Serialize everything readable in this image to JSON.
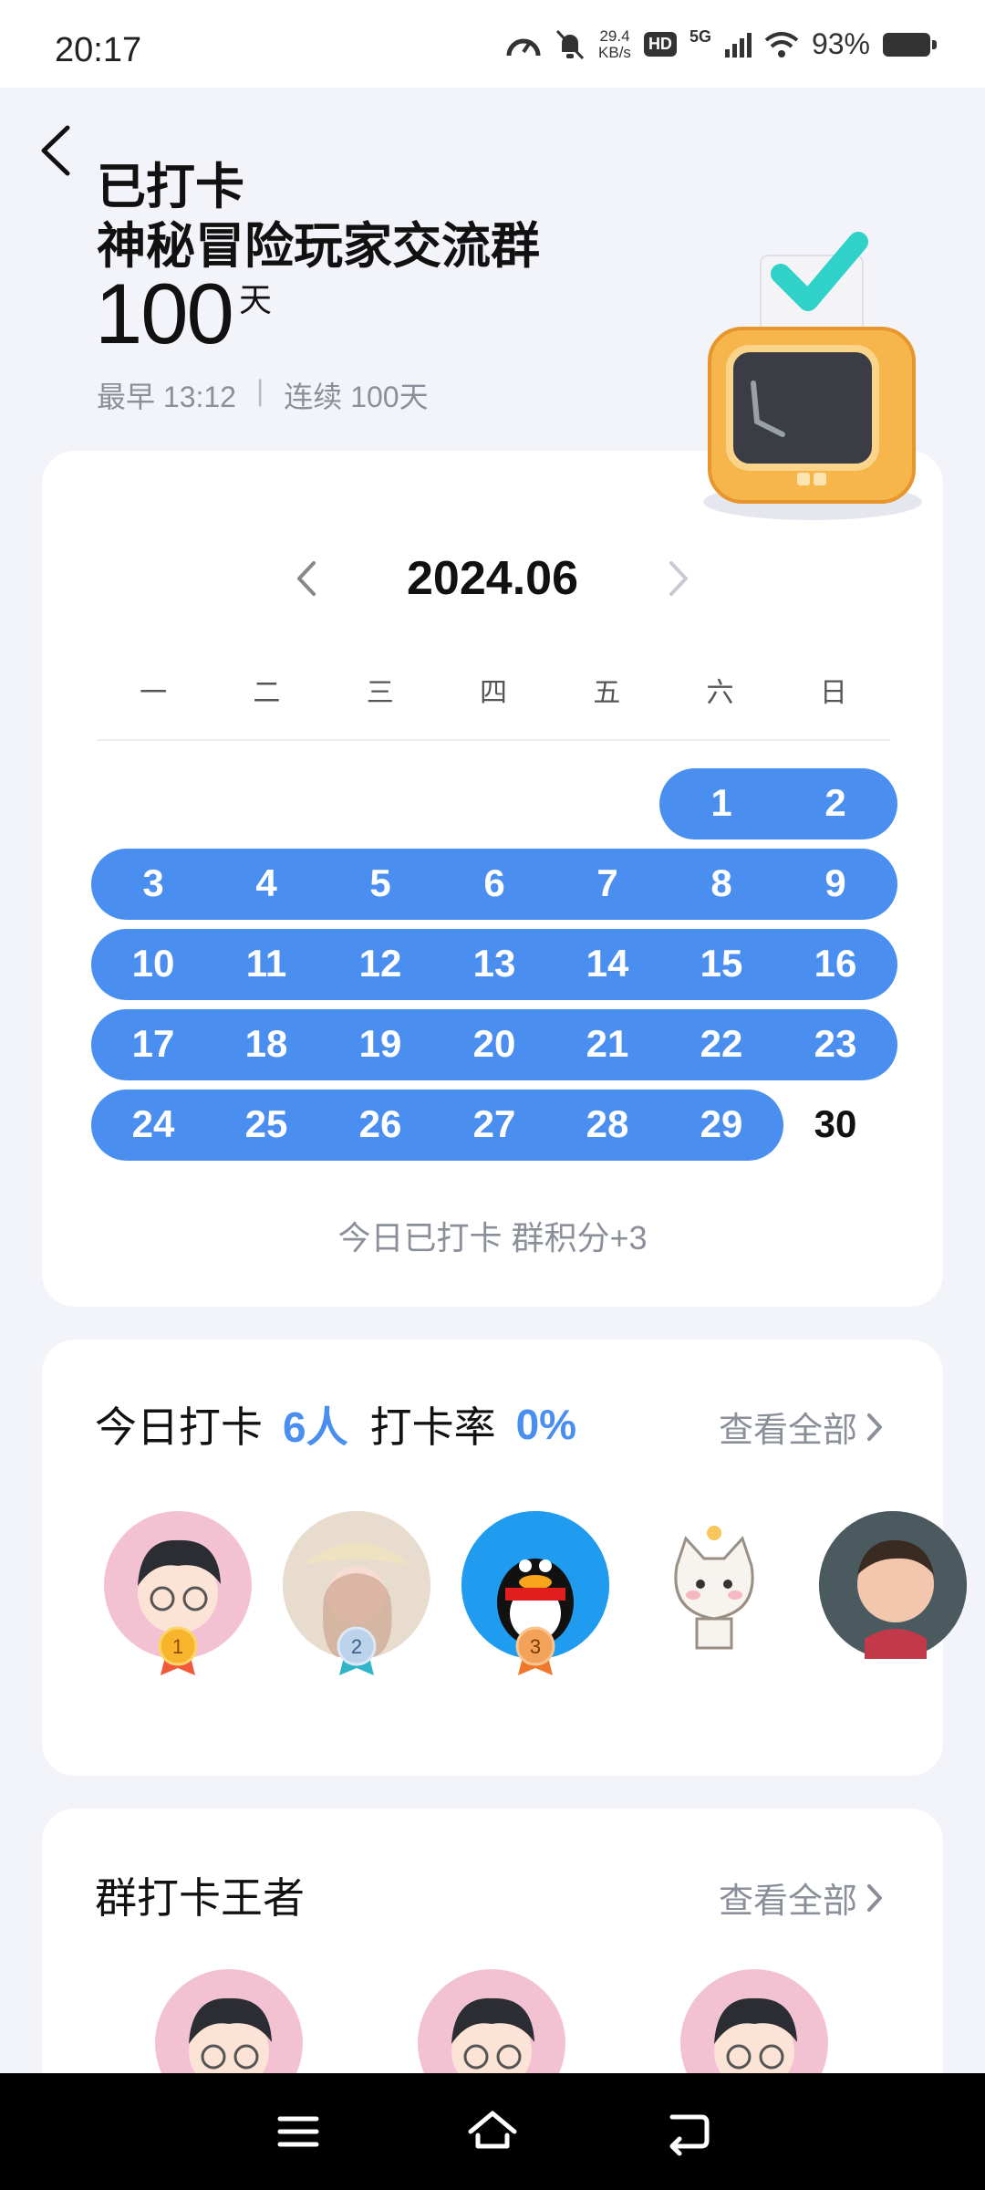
{
  "status_bar": {
    "time": "20:17",
    "net_speed_value": "29.4",
    "net_speed_unit": "KB/s",
    "hd": "HD",
    "network": "5G",
    "battery": "93%",
    "icons": [
      "speedometer-icon",
      "mute-bell-icon",
      "signal-icon",
      "wifi-icon",
      "battery-icon"
    ]
  },
  "header": {
    "title_line1": "已打卡",
    "title_line2": "神秘冒险玩家交流群",
    "days": "100",
    "days_unit": "天",
    "earliest": "最早 13:12",
    "separator": "|",
    "streak": "连续 100天"
  },
  "calendar": {
    "month": "2024.06",
    "weekdays": [
      "一",
      "二",
      "三",
      "四",
      "五",
      "六",
      "日"
    ],
    "days": [
      "1",
      "2",
      "3",
      "4",
      "5",
      "6",
      "7",
      "8",
      "9",
      "10",
      "11",
      "12",
      "13",
      "14",
      "15",
      "16",
      "17",
      "18",
      "19",
      "20",
      "21",
      "22",
      "23",
      "24",
      "25",
      "26",
      "27",
      "28",
      "29",
      "30"
    ],
    "checked_through": 29,
    "today_note": "今日已打卡  群积分+3",
    "accent_color": "#4a8ef0"
  },
  "ranking": {
    "label": "今日打卡",
    "count": "6人",
    "rate_label": "打卡率",
    "rate": "0%",
    "view_all": "查看全部",
    "badges": [
      "1",
      "2",
      "3"
    ]
  },
  "king": {
    "title": "群打卡王者",
    "view_all": "查看全部"
  },
  "nav": {
    "icons": [
      "menu-icon",
      "home-icon",
      "back-icon"
    ]
  }
}
